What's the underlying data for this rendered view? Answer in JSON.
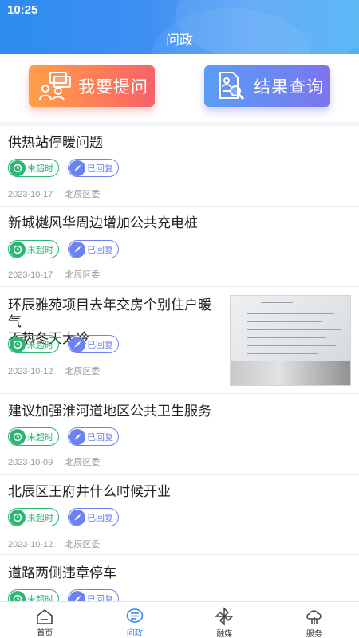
{
  "status_bar": {
    "time": "10:25"
  },
  "header": {
    "title": "问政"
  },
  "actions": {
    "ask_label": "我要提问",
    "result_label": "结果查询"
  },
  "items": [
    {
      "title": "供热站停暖问题",
      "tag_time": "未超时",
      "tag_reply": "已回复",
      "date": "2023-10-17",
      "dept": "北辰区委"
    },
    {
      "title": "新城樾风华周边增加公共充电桩",
      "tag_time": "未超时",
      "tag_reply": "已回复",
      "date": "2023-10-17",
      "dept": "北辰区委"
    },
    {
      "title": "环辰雅苑项目去年交房个别住户暖气不热冬天太冷",
      "title_line1": "环辰雅苑项目去年交房个别住户暖气",
      "title_line2": "不热冬天太冷",
      "tag_time": "未超时",
      "tag_reply": "已回复",
      "date": "2023-10-12",
      "dept": "北辰区委",
      "thumbnail": "document-photo"
    },
    {
      "title": "建议加强淮河道地区公共卫生服务",
      "tag_time": "未超时",
      "tag_reply": "已回复",
      "date": "2023-10-09",
      "dept": "北辰区委"
    },
    {
      "title": "北辰区王府井什么时候开业",
      "tag_time": "未超时",
      "tag_reply": "已回复",
      "date": "2023-10-12",
      "dept": "北辰区委"
    },
    {
      "title": "道路两侧违章停车",
      "tag_time": "未超时",
      "tag_reply": "已回复"
    }
  ],
  "tabbar": {
    "tabs": [
      {
        "label": "首页",
        "icon": "home-icon"
      },
      {
        "label": "问政",
        "icon": "message-list-icon",
        "active": true
      },
      {
        "label": "融媒",
        "icon": "pinwheel-icon"
      },
      {
        "label": "服务",
        "icon": "cloud-service-icon"
      }
    ]
  },
  "colors": {
    "header_blue": "#3f8ff2",
    "ask_orange": "#ff8a50",
    "result_purple": "#7180f0",
    "tag_green": "#2bb673",
    "tag_blue": "#6b82f0",
    "tab_active": "#3a87f0"
  }
}
